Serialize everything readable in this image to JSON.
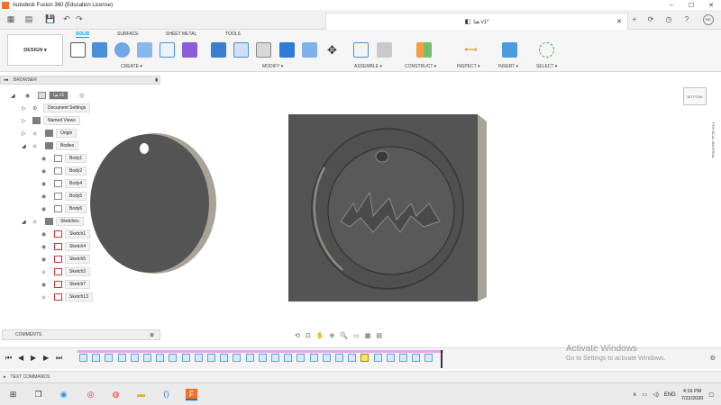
{
  "window": {
    "title": "Autodesk Fusion 360 (Education License)",
    "doc_tab_title": "هيا v1*"
  },
  "ribbon": {
    "workspace": "DESIGN ▾",
    "tabs": [
      "SOLID",
      "SURFACE",
      "SHEET METAL",
      "TOOLS"
    ],
    "active_tab": "SOLID",
    "groups": [
      "CREATE ▾",
      "MODIFY ▾",
      "ASSEMBLE ▾",
      "CONSTRUCT ▾",
      "INSPECT ▾",
      "INSERT ▾",
      "SELECT ▾"
    ]
  },
  "browser": {
    "title": "BROWSER",
    "root": "هيا v1",
    "items": [
      {
        "label": "Document Settings"
      },
      {
        "label": "Named Views"
      },
      {
        "label": "Origin"
      },
      {
        "label": "Bodies"
      },
      {
        "label": "Body1"
      },
      {
        "label": "Body2"
      },
      {
        "label": "Body4"
      },
      {
        "label": "Body5"
      },
      {
        "label": "Body6"
      },
      {
        "label": "Sketches"
      },
      {
        "label": "Sketch1"
      },
      {
        "label": "Sketch4"
      },
      {
        "label": "Sketch5"
      },
      {
        "label": "Sketch3"
      },
      {
        "label": "Sketch7"
      },
      {
        "label": "Sketch13"
      }
    ]
  },
  "viewcube": {
    "label": "BOTTOM"
  },
  "side_panel": {
    "label": "PHYSICAL MATERIAL"
  },
  "comments": {
    "label": "COMMENTS"
  },
  "text_commands": {
    "label": "TEXT COMMANDS"
  },
  "watermark": {
    "line1": "Activate Windows",
    "line2": "Go to Settings to activate Windows."
  },
  "taskbar": {
    "language": "ENG",
    "time": "4:16 PM",
    "date": "7/22/2020"
  },
  "colors": {
    "accent": "#0696d7",
    "timeline_track": "#e5a4f5",
    "body_dark": "#545454",
    "body_edge": "#a9a397"
  }
}
